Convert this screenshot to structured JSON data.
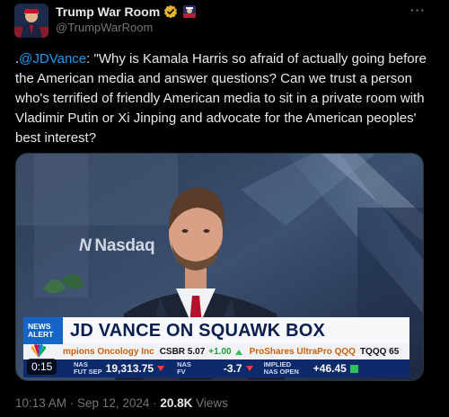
{
  "author": {
    "display_name": "Trump War Room",
    "handle": "@TrumpWarRoom",
    "verified_icon": "verified-badge-icon",
    "affiliate_icon": "affiliate-badge-icon"
  },
  "more_label": "···",
  "tweet": {
    "prefix": ".",
    "mention": "@JDVance",
    "text": ": \"Why is Kamala Harris so afraid of actually going before the American media and answer questions? Can we trust a person who's terrified of friendly American media to sit in a private room with Vladimir Putin or Xi Jinping and advocate for the American peoples' best interest?"
  },
  "media": {
    "background_text": "Nasdaq",
    "news_alert": [
      "NEWS",
      "ALERT"
    ],
    "headline": "JD VANCE ON SQUAWK BOX",
    "ticker_line1": {
      "a": "mpions Oncology Inc",
      "b": "CSBR 5.07",
      "c": "+1.00",
      "d": "ProShares UltraPro QQQ",
      "e": "TQQQ 65"
    },
    "ticker_line2": {
      "l1a": "NAS",
      "l1b": "FUT SEP",
      "v1": "19,313.75",
      "l2a": "NAS",
      "l2b": "FV",
      "v2": "-3.7",
      "l3a": "IMPLIED",
      "l3b": "NAS OPEN",
      "v3": "+46.45"
    },
    "timecode": "0:15"
  },
  "meta": {
    "time": "10:13 AM · Sep 12, 2024 · ",
    "views_count": "20.8K",
    "views_label": " Views"
  }
}
